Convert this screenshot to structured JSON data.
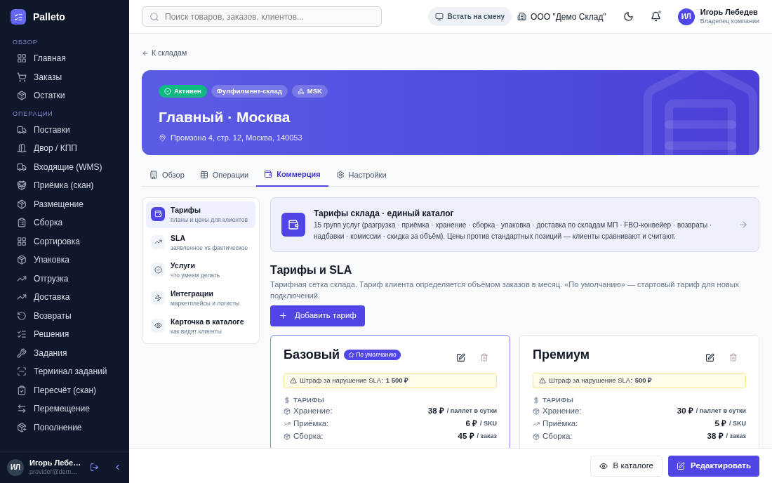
{
  "sidebar": {
    "brand": "Palleto",
    "sections": [
      {
        "title": "ОБЗОР",
        "items": [
          "Главная",
          "Заказы",
          "Остатки"
        ]
      },
      {
        "title": "ОПЕРАЦИИ",
        "items": [
          "Поставки",
          "Двор / КПП",
          "Входящие (WMS)",
          "Приёмка (скан)",
          "Размещение",
          "Сборка",
          "Сортировка",
          "Упаковка",
          "Отгрузка",
          "Доставка",
          "Возвраты",
          "Решения",
          "Задания",
          "Терминал заданий",
          "Пересчёт (скан)",
          "Перемещение",
          "Пополнение"
        ]
      }
    ],
    "user": {
      "initials": "ИЛ",
      "name": "Игорь Лебе…",
      "email": "provider@dem…"
    }
  },
  "topbar": {
    "search": {
      "placeholder": "Поиск товаров, заказов, клиентов..."
    },
    "shift_button": "Встать на смену",
    "company": "ООО \"Демо Склад\"",
    "has_unread": true,
    "user": {
      "initials": "ИЛ",
      "name": "Игорь Лебедев",
      "role": "Владелец компании"
    }
  },
  "back_link": "К складам",
  "hero": {
    "badges": [
      {
        "kind": "status",
        "label": "Активен"
      },
      {
        "kind": "type",
        "label": "Фулфилмент-склад"
      },
      {
        "kind": "region",
        "label": "MSK"
      }
    ],
    "title": "Главный · Москва",
    "address": "Промзона 4, стр. 12, Москва, 140053"
  },
  "tabs": [
    {
      "label": "Обзор",
      "selected": false
    },
    {
      "label": "Операции",
      "selected": false
    },
    {
      "label": "Коммерция",
      "selected": true
    },
    {
      "label": "Настройки",
      "selected": false
    }
  ],
  "submenu": [
    {
      "title": "Тарифы",
      "subtitle": "планы и цены для клиентов",
      "selected": true
    },
    {
      "title": "SLA",
      "subtitle": "заявленное vs фактическое",
      "selected": false
    },
    {
      "title": "Услуги",
      "subtitle": "что умеем делать",
      "selected": false
    },
    {
      "title": "Интеграции",
      "subtitle": "маркетплейсы и логисты",
      "selected": false
    },
    {
      "title": "Карточка в каталоге",
      "subtitle": "как видят клиенты",
      "selected": false
    }
  ],
  "info_card": {
    "title": "Тарифы склада · единый каталог",
    "text": "15 групп услуг (разгрузка · приёмка · хранение · сборка · упаковка · доставка по складам МП · FBO-конвейер · возвраты · надбавки · комиссии · скидка за объём). Цены против стандартных позиций — клиенты сравнивают и считают."
  },
  "section": {
    "title": "Тарифы и SLA",
    "description": "Тарифная сетка склада. Тариф клиента определяется объёмом заказов в месяц. «По умолчанию» — стартовый тариф для новых подключений.",
    "add_button": "Добавить тариф"
  },
  "tariffs": [
    {
      "name": "Базовый",
      "is_default": true,
      "default_label": "По умолчанию",
      "penalty_label": "Штраф за нарушение SLA:",
      "penalty_value": "1 500 ₽",
      "rates_title": "ТАРИФЫ",
      "rates": [
        {
          "label": "Хранение:",
          "value": "38 ₽",
          "unit": "/ паллет в сутки"
        },
        {
          "label": "Приёмка:",
          "value": "6 ₽",
          "unit": "/ SKU"
        },
        {
          "label": "Сборка:",
          "value": "45 ₽",
          "unit": "/ заказ"
        }
      ]
    },
    {
      "name": "Премиум",
      "is_default": false,
      "penalty_label": "Штраф за нарушение SLA:",
      "penalty_value": "500 ₽",
      "rates_title": "ТАРИФЫ",
      "rates": [
        {
          "label": "Хранение:",
          "value": "30 ₽",
          "unit": "/ паллет в сутки"
        },
        {
          "label": "Приёмка:",
          "value": "5 ₽",
          "unit": "/ SKU"
        },
        {
          "label": "Сборка:",
          "value": "38 ₽",
          "unit": "/ заказ"
        }
      ]
    }
  ],
  "footer": {
    "catalog_button": "В каталоге",
    "edit_button": "Редактировать"
  }
}
